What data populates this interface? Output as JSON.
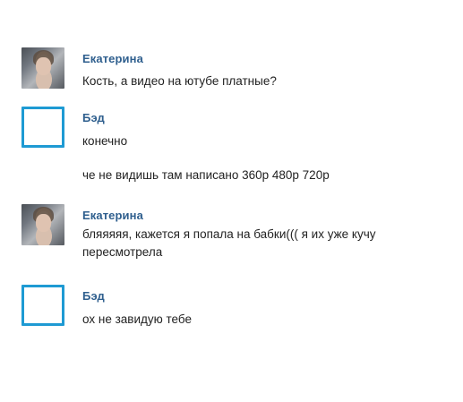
{
  "messages": [
    {
      "sender": "Екатерина",
      "avatar": "photo-avatar",
      "lines": [
        "Кость, а видео на ютубе платные?"
      ]
    },
    {
      "sender": "Бэд",
      "avatar": "empty-avatar",
      "lines": [
        "конечно",
        "че не видишь там написано 360р 480р 720р"
      ]
    },
    {
      "sender": "Екатерина",
      "avatar": "photo-avatar",
      "lines": [
        "бляяяяя, кажется я попала на бабки((( я их уже кучу пересмотрела"
      ]
    },
    {
      "sender": "Бэд",
      "avatar": "empty-avatar",
      "lines": [
        "ох не завидую тебе"
      ]
    }
  ],
  "colors": {
    "sender_name": "#2f5f8e",
    "message_text": "#222222",
    "empty_avatar_border": "#1e9ad3",
    "background": "#ffffff"
  }
}
